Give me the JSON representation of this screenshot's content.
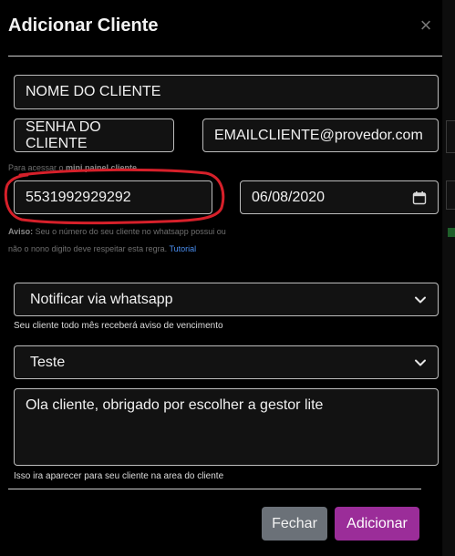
{
  "modal": {
    "title": "Adicionar Cliente",
    "close_icon": "×"
  },
  "form": {
    "name_value": "NOME DO CLIENTE",
    "password_value": "SENHA DO CLIENTE",
    "email_value": "EMAILCLIENTE@provedor.com",
    "password_hint_prefix": "Para acessar o ",
    "password_hint_strong": "mini painel cliente",
    "phone_value": "5531992929292",
    "date_value": "06/08/2020",
    "warning_label": "Aviso:",
    "warning_text": " Seu o número do seu cliente no whatsapp possui ou não o nono digito deve respeitar esta regra. ",
    "warning_link": "Tutorial",
    "notify_select_value": "Notificar via whatsapp",
    "notify_help": "Seu cliente todo mês receberá aviso de vencimento",
    "template_select_value": "Teste",
    "message_value": "Ola cliente, obrigado por escolher a gestor lite",
    "message_help": "Isso ira aparecer para seu cliente na area do cliente"
  },
  "footer": {
    "close_label": "Fechar",
    "add_label": "Adicionar"
  },
  "colors": {
    "primary_button": "#9b2d99",
    "secondary_button": "#6b7178",
    "annotation_circle": "#d6202a",
    "link": "#4a8ff2"
  },
  "icons": {
    "close": "close-icon",
    "select_arrow": "chevron-down-icon",
    "calendar": "calendar-icon"
  }
}
